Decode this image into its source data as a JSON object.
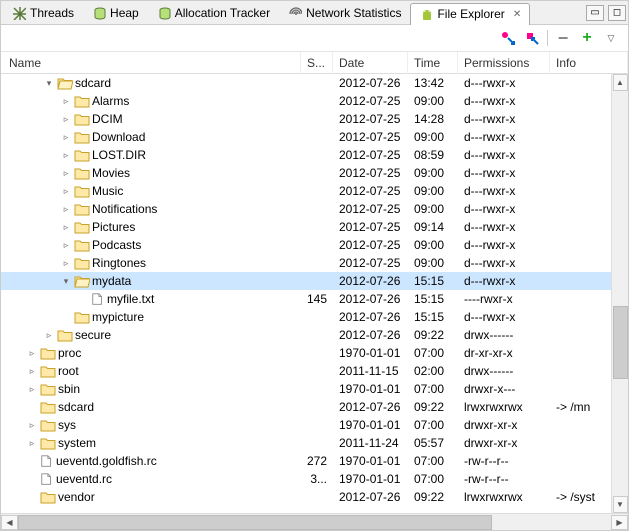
{
  "tabs": [
    {
      "label": "Threads",
      "icon": "threads"
    },
    {
      "label": "Heap",
      "icon": "heap"
    },
    {
      "label": "Allocation Tracker",
      "icon": "heap"
    },
    {
      "label": "Network Statistics",
      "icon": "net"
    },
    {
      "label": "File Explorer",
      "icon": "android",
      "active": true
    }
  ],
  "columns": {
    "name": "Name",
    "size": "S...",
    "date": "Date",
    "time": "Time",
    "perm": "Permissions",
    "info": "Info"
  },
  "rows": [
    {
      "depth": 2,
      "exp": "▾",
      "icon": "folder-open",
      "name": "sdcard",
      "size": "",
      "date": "2012-07-26",
      "time": "13:42",
      "perm": "d---rwxr-x",
      "info": ""
    },
    {
      "depth": 3,
      "exp": "▹",
      "icon": "folder",
      "name": "Alarms",
      "size": "",
      "date": "2012-07-25",
      "time": "09:00",
      "perm": "d---rwxr-x",
      "info": ""
    },
    {
      "depth": 3,
      "exp": "▹",
      "icon": "folder",
      "name": "DCIM",
      "size": "",
      "date": "2012-07-25",
      "time": "14:28",
      "perm": "d---rwxr-x",
      "info": ""
    },
    {
      "depth": 3,
      "exp": "▹",
      "icon": "folder",
      "name": "Download",
      "size": "",
      "date": "2012-07-25",
      "time": "09:00",
      "perm": "d---rwxr-x",
      "info": ""
    },
    {
      "depth": 3,
      "exp": "▹",
      "icon": "folder",
      "name": "LOST.DIR",
      "size": "",
      "date": "2012-07-25",
      "time": "08:59",
      "perm": "d---rwxr-x",
      "info": ""
    },
    {
      "depth": 3,
      "exp": "▹",
      "icon": "folder",
      "name": "Movies",
      "size": "",
      "date": "2012-07-25",
      "time": "09:00",
      "perm": "d---rwxr-x",
      "info": ""
    },
    {
      "depth": 3,
      "exp": "▹",
      "icon": "folder",
      "name": "Music",
      "size": "",
      "date": "2012-07-25",
      "time": "09:00",
      "perm": "d---rwxr-x",
      "info": ""
    },
    {
      "depth": 3,
      "exp": "▹",
      "icon": "folder",
      "name": "Notifications",
      "size": "",
      "date": "2012-07-25",
      "time": "09:00",
      "perm": "d---rwxr-x",
      "info": ""
    },
    {
      "depth": 3,
      "exp": "▹",
      "icon": "folder",
      "name": "Pictures",
      "size": "",
      "date": "2012-07-25",
      "time": "09:14",
      "perm": "d---rwxr-x",
      "info": ""
    },
    {
      "depth": 3,
      "exp": "▹",
      "icon": "folder",
      "name": "Podcasts",
      "size": "",
      "date": "2012-07-25",
      "time": "09:00",
      "perm": "d---rwxr-x",
      "info": ""
    },
    {
      "depth": 3,
      "exp": "▹",
      "icon": "folder",
      "name": "Ringtones",
      "size": "",
      "date": "2012-07-25",
      "time": "09:00",
      "perm": "d---rwxr-x",
      "info": ""
    },
    {
      "depth": 3,
      "exp": "▾",
      "icon": "folder-open",
      "name": "mydata",
      "size": "",
      "date": "2012-07-26",
      "time": "15:15",
      "perm": "d---rwxr-x",
      "info": "",
      "selected": true
    },
    {
      "depth": 4,
      "exp": "",
      "icon": "file",
      "name": "myfile.txt",
      "size": "145",
      "date": "2012-07-26",
      "time": "15:15",
      "perm": "----rwxr-x",
      "info": ""
    },
    {
      "depth": 3,
      "exp": "",
      "icon": "folder",
      "name": "mypicture",
      "size": "",
      "date": "2012-07-26",
      "time": "15:15",
      "perm": "d---rwxr-x",
      "info": ""
    },
    {
      "depth": 2,
      "exp": "▹",
      "icon": "folder",
      "name": "secure",
      "size": "",
      "date": "2012-07-26",
      "time": "09:22",
      "perm": "drwx------",
      "info": ""
    },
    {
      "depth": 1,
      "exp": "▹",
      "icon": "folder",
      "name": "proc",
      "size": "",
      "date": "1970-01-01",
      "time": "07:00",
      "perm": "dr-xr-xr-x",
      "info": ""
    },
    {
      "depth": 1,
      "exp": "▹",
      "icon": "folder",
      "name": "root",
      "size": "",
      "date": "2011-11-15",
      "time": "02:00",
      "perm": "drwx------",
      "info": ""
    },
    {
      "depth": 1,
      "exp": "▹",
      "icon": "folder",
      "name": "sbin",
      "size": "",
      "date": "1970-01-01",
      "time": "07:00",
      "perm": "drwxr-x---",
      "info": ""
    },
    {
      "depth": 1,
      "exp": "",
      "icon": "folder",
      "name": "sdcard",
      "size": "",
      "date": "2012-07-26",
      "time": "09:22",
      "perm": "lrwxrwxrwx",
      "info": "-> /mn"
    },
    {
      "depth": 1,
      "exp": "▹",
      "icon": "folder",
      "name": "sys",
      "size": "",
      "date": "1970-01-01",
      "time": "07:00",
      "perm": "drwxr-xr-x",
      "info": ""
    },
    {
      "depth": 1,
      "exp": "▹",
      "icon": "folder",
      "name": "system",
      "size": "",
      "date": "2011-11-24",
      "time": "05:57",
      "perm": "drwxr-xr-x",
      "info": ""
    },
    {
      "depth": 1,
      "exp": "",
      "icon": "file",
      "name": "ueventd.goldfish.rc",
      "size": "272",
      "date": "1970-01-01",
      "time": "07:00",
      "perm": "-rw-r--r--",
      "info": ""
    },
    {
      "depth": 1,
      "exp": "",
      "icon": "file",
      "name": "ueventd.rc",
      "size": "3...",
      "date": "1970-01-01",
      "time": "07:00",
      "perm": "-rw-r--r--",
      "info": ""
    },
    {
      "depth": 1,
      "exp": "",
      "icon": "folder",
      "name": "vendor",
      "size": "",
      "date": "2012-07-26",
      "time": "09:22",
      "perm": "lrwxrwxrwx",
      "info": "-> /syst"
    }
  ]
}
